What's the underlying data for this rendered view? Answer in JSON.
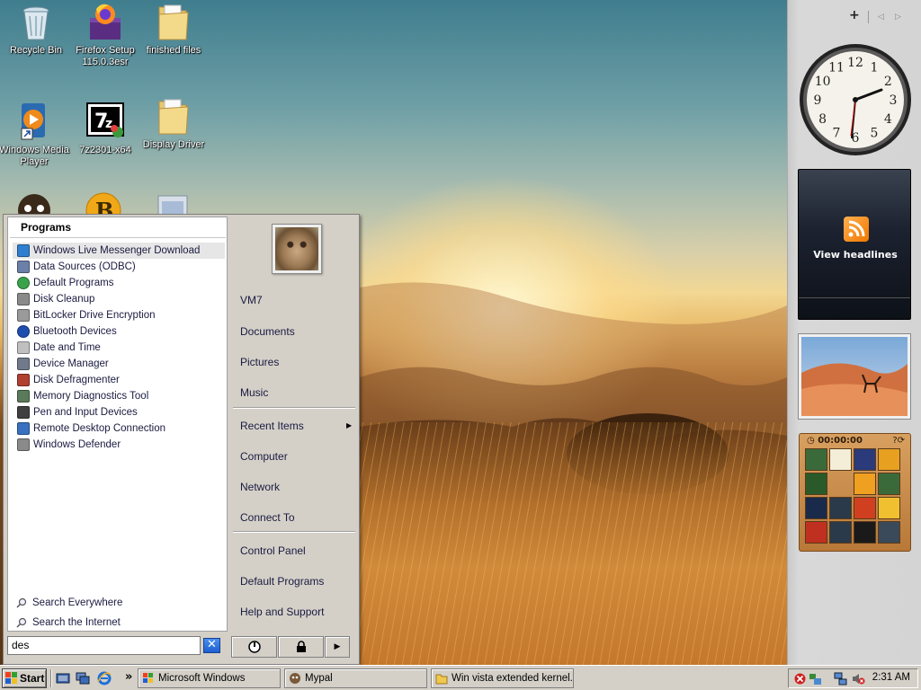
{
  "desktop": {
    "icons": [
      {
        "label": "Recycle Bin"
      },
      {
        "label": "Firefox Setup 115.0.3esr"
      },
      {
        "label": "finished files"
      },
      {
        "label": "Windows Media Player"
      },
      {
        "label": "7z2301-x64"
      },
      {
        "label": "Display Driver"
      }
    ]
  },
  "sidebar": {
    "add_symbol": "+",
    "prev_symbol": "◁",
    "next_symbol": "▷",
    "clock_numbers": [
      "12",
      "1",
      "2",
      "3",
      "4",
      "5",
      "6",
      "7",
      "8",
      "9",
      "10",
      "11"
    ],
    "feed_label": "View headlines",
    "puzzle_timer": "00:00:00"
  },
  "start_menu": {
    "programs_header": "Programs",
    "programs": [
      {
        "label": "Windows Live Messenger Download",
        "icon": "messenger-icon",
        "color": "#2f7fd0"
      },
      {
        "label": "Data Sources (ODBC)",
        "icon": "odbc-icon",
        "color": "#6c7fa8"
      },
      {
        "label": "Default Programs",
        "icon": "default-programs-icon",
        "color": "#3aa34a"
      },
      {
        "label": "Disk Cleanup",
        "icon": "disk-cleanup-icon",
        "color": "#8a8a8a"
      },
      {
        "label": "BitLocker Drive Encryption",
        "icon": "bitlocker-icon",
        "color": "#9a9a9a"
      },
      {
        "label": "Bluetooth Devices",
        "icon": "bluetooth-icon",
        "color": "#1e4fb0"
      },
      {
        "label": "Date and Time",
        "icon": "clock-icon",
        "color": "#c0c0c0"
      },
      {
        "label": "Device Manager",
        "icon": "device-manager-icon",
        "color": "#707a8a"
      },
      {
        "label": "Disk Defragmenter",
        "icon": "defrag-icon",
        "color": "#b04030"
      },
      {
        "label": "Memory Diagnostics Tool",
        "icon": "memory-icon",
        "color": "#5a7a5a"
      },
      {
        "label": "Pen and Input Devices",
        "icon": "pen-icon",
        "color": "#404040"
      },
      {
        "label": "Remote Desktop Connection",
        "icon": "remote-desktop-icon",
        "color": "#3a70c0"
      },
      {
        "label": "Windows Defender",
        "icon": "defender-icon",
        "color": "#8a8a8a"
      }
    ],
    "search_everywhere": "Search Everywhere",
    "search_internet": "Search the Internet",
    "search_value": "des",
    "clear_symbol": "✕",
    "right_items": {
      "user": "VM7",
      "documents": "Documents",
      "pictures": "Pictures",
      "music": "Music",
      "recent": "Recent Items",
      "computer": "Computer",
      "network": "Network",
      "connect": "Connect To",
      "control_panel": "Control Panel",
      "default_programs": "Default Programs",
      "help": "Help and Support"
    },
    "arrow_symbol": "▶"
  },
  "taskbar": {
    "start_label": "Start",
    "overflow_symbol": "»",
    "tasks": [
      {
        "label": "Microsoft Windows"
      },
      {
        "label": "Mypal"
      },
      {
        "label": "Win vista extended kernel..."
      }
    ],
    "clock": "2:31 AM"
  }
}
